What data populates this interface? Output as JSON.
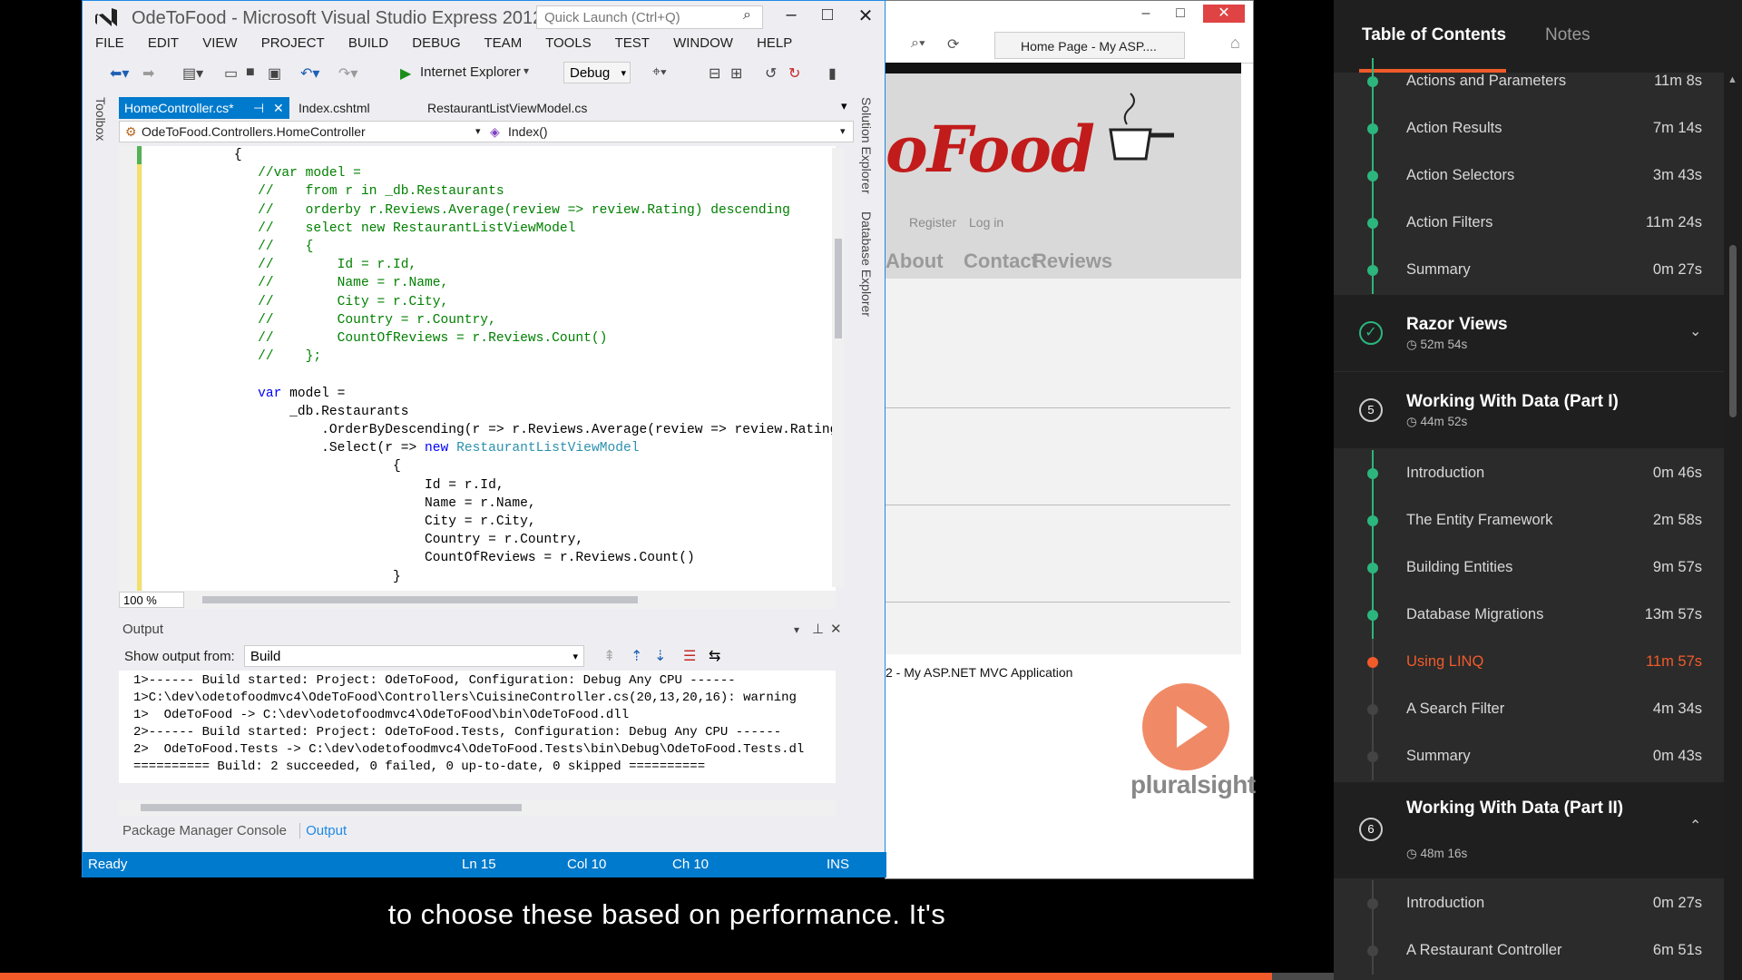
{
  "browser": {
    "tab_title": "Home Page - My ASP....",
    "site_logo": "oFood",
    "auth_links": [
      "Register",
      "Log in"
    ],
    "nav_links": [
      "About",
      "Contact",
      "Reviews"
    ],
    "footer": "2 - My ASP.NET MVC Application",
    "watermark": "pluralsight"
  },
  "vs": {
    "title": "OdeToFood - Microsoft Visual Studio Express 2012...",
    "quick_launch": "Quick Launch (Ctrl+Q)",
    "menu": [
      "FILE",
      "EDIT",
      "VIEW",
      "PROJECT",
      "BUILD",
      "DEBUG",
      "TEAM",
      "TOOLS",
      "TEST",
      "WINDOW",
      "HELP"
    ],
    "run_target": "Internet Explorer",
    "config": "Debug",
    "side_left": "Toolbox",
    "side_right_1": "Solution Explorer",
    "side_right_2": "Database Explorer",
    "tabs": [
      "HomeController.cs*",
      "Index.cshtml",
      "RestaurantListViewModel.cs"
    ],
    "nav_class": "OdeToFood.Controllers.HomeController",
    "nav_member": "Index()",
    "zoom": "100 %",
    "output": {
      "title": "Output",
      "show_from_label": "Show output from:",
      "source": "Build",
      "lines": [
        "1>------ Build started: Project: OdeToFood, Configuration: Debug Any CPU ------",
        "1>C:\\dev\\odetofoodmvc4\\OdeToFood\\Controllers\\CuisineController.cs(20,13,20,16): warning",
        "1>  OdeToFood -> C:\\dev\\odetofoodmvc4\\OdeToFood\\bin\\OdeToFood.dll",
        "2>------ Build started: Project: OdeToFood.Tests, Configuration: Debug Any CPU ------",
        "2>  OdeToFood.Tests -> C:\\dev\\odetofoodmvc4\\OdeToFood.Tests\\bin\\Debug\\OdeToFood.Tests.dl",
        "========== Build: 2 succeeded, 0 failed, 0 up-to-date, 0 skipped =========="
      ]
    },
    "bottom_tabs": [
      "Package Manager Console",
      "Output"
    ],
    "status": {
      "state": "Ready",
      "ln": "Ln 15",
      "col": "Col 10",
      "ch": "Ch 10",
      "mode": "INS"
    }
  },
  "subtitle": "to choose these based on performance. It's",
  "progress_fraction": 0.73,
  "toc": {
    "tabs": [
      "Table of Contents",
      "Notes"
    ],
    "clips_top": [
      {
        "title": "Actions and Parameters",
        "duration": "11m 8s",
        "state": "done"
      },
      {
        "title": "Action Results",
        "duration": "7m 14s",
        "state": "done"
      },
      {
        "title": "Action Selectors",
        "duration": "3m 43s",
        "state": "done"
      },
      {
        "title": "Action Filters",
        "duration": "11m 24s",
        "state": "done"
      },
      {
        "title": "Summary",
        "duration": "0m 27s",
        "state": "done"
      }
    ],
    "module_razor": {
      "title": "Razor Views",
      "duration": "52m 54s"
    },
    "module_5": {
      "number": "5",
      "title": "Working With Data (Part I)",
      "duration": "44m 52s"
    },
    "clips_mid": [
      {
        "title": "Introduction",
        "duration": "0m 46s",
        "state": "done"
      },
      {
        "title": "The Entity Framework",
        "duration": "2m 58s",
        "state": "done"
      },
      {
        "title": "Building Entities",
        "duration": "9m 57s",
        "state": "done"
      },
      {
        "title": "Database Migrations",
        "duration": "13m 57s",
        "state": "done"
      },
      {
        "title": "Using LINQ",
        "duration": "11m 57s",
        "state": "current"
      },
      {
        "title": "A Search Filter",
        "duration": "4m 34s",
        "state": "todo"
      },
      {
        "title": "Summary",
        "duration": "0m 43s",
        "state": "todo"
      }
    ],
    "module_6": {
      "number": "6",
      "title": "Working With Data (Part II)",
      "duration": "48m 16s"
    },
    "clips_bottom": [
      {
        "title": "Introduction",
        "duration": "0m 27s",
        "state": "todo"
      },
      {
        "title": "A Restaurant Controller",
        "duration": "6m 51s",
        "state": "todo"
      }
    ]
  }
}
